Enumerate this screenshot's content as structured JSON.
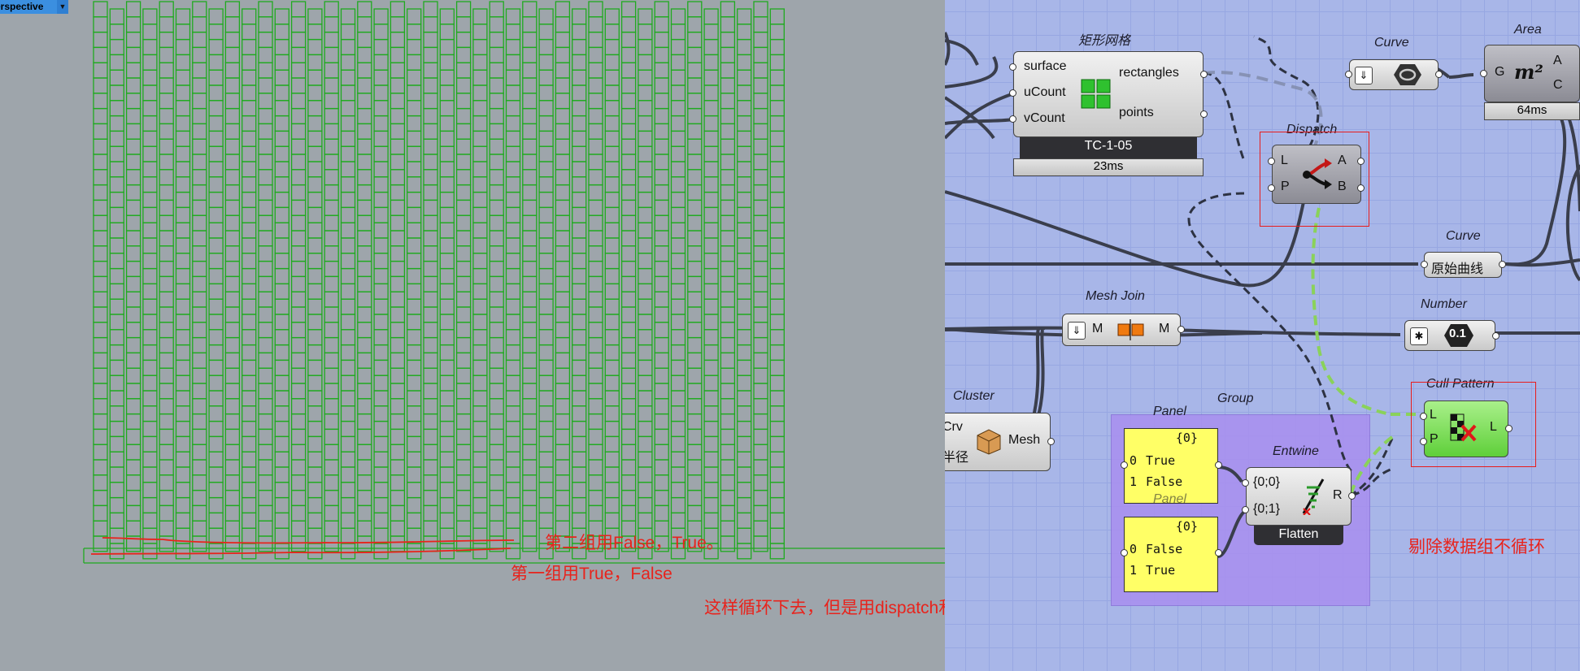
{
  "viewport": {
    "name": "Perspective",
    "name_visible": "erspective"
  },
  "canvas": {
    "rect_grid": {
      "title": "矩形网格",
      "inputs": [
        "surface",
        "uCount",
        "vCount"
      ],
      "outputs": [
        "rectangles",
        "points"
      ],
      "nickname": "TC-1-05",
      "time": "23ms"
    },
    "curve_top": {
      "title": "Curve"
    },
    "area": {
      "title": "Area",
      "input": "G",
      "outputs": [
        "A",
        "C"
      ],
      "icon_text": "m²",
      "time": "64ms"
    },
    "dispatch": {
      "title": "Dispatch",
      "inputs": [
        "L",
        "P"
      ],
      "outputs": [
        "A",
        "B"
      ]
    },
    "curve_orig": {
      "title": "Curve",
      "label": "原始曲线"
    },
    "number": {
      "title": "Number",
      "icon_text": "0.1"
    },
    "mesh_join": {
      "title": "Mesh Join",
      "input": "M",
      "output": "M"
    },
    "cluster": {
      "title": "Cluster",
      "inputs": [
        "Crv",
        "半径"
      ],
      "output": "Mesh"
    },
    "group": {
      "title": "Group"
    },
    "panel1": {
      "title": "Panel",
      "header": "{0}",
      "rows": [
        {
          "i": "0",
          "v": "True"
        },
        {
          "i": "1",
          "v": "False"
        }
      ]
    },
    "panel2": {
      "title": "Panel",
      "header": "{0}",
      "rows": [
        {
          "i": "0",
          "v": "False"
        },
        {
          "i": "1",
          "v": "True"
        }
      ]
    },
    "entwine": {
      "title": "Entwine",
      "inputs": [
        "{0;0}",
        "{0;1}"
      ],
      "output": "R",
      "footer": "Flatten"
    },
    "cull": {
      "title": "Cull Pattern",
      "inputs": [
        "L",
        "P"
      ],
      "output": "L"
    }
  },
  "annotations": {
    "second_group": "第二组用False，True。",
    "first_group": "第一组用True，False",
    "loop_note": "这样循环下去，但是用dispatch和cullpattern都没办法",
    "cull_note": "剔除数据组不循环"
  },
  "colors": {
    "viewport_bg": "#9ea5ab",
    "canvas_bg": "#a8b6e8",
    "grid_line": "#1faa1f",
    "annotation": "#e8231c",
    "panel": "#ffff66",
    "group": "#a98ff0"
  }
}
